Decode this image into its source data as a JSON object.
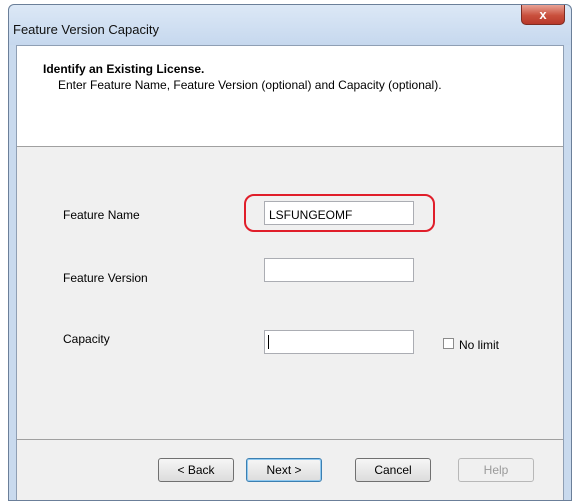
{
  "window": {
    "title": "Feature  Version Capacity",
    "close_glyph": "x"
  },
  "header": {
    "title": "Identify an Existing License.",
    "subtitle": "Enter Feature Name, Feature Version (optional) and Capacity (optional)."
  },
  "form": {
    "feature_name": {
      "label": "Feature Name",
      "value": "LSFUNGEOMF"
    },
    "feature_version": {
      "label": "Feature Version",
      "value": ""
    },
    "capacity": {
      "label": "Capacity",
      "value": ""
    },
    "no_limit": {
      "label": "No limit",
      "checked": false
    }
  },
  "buttons": {
    "back": "< Back",
    "next": "Next >",
    "cancel": "Cancel",
    "help": "Help"
  },
  "colors": {
    "highlight": "#e01e2a",
    "close_button": "#c9503d"
  }
}
